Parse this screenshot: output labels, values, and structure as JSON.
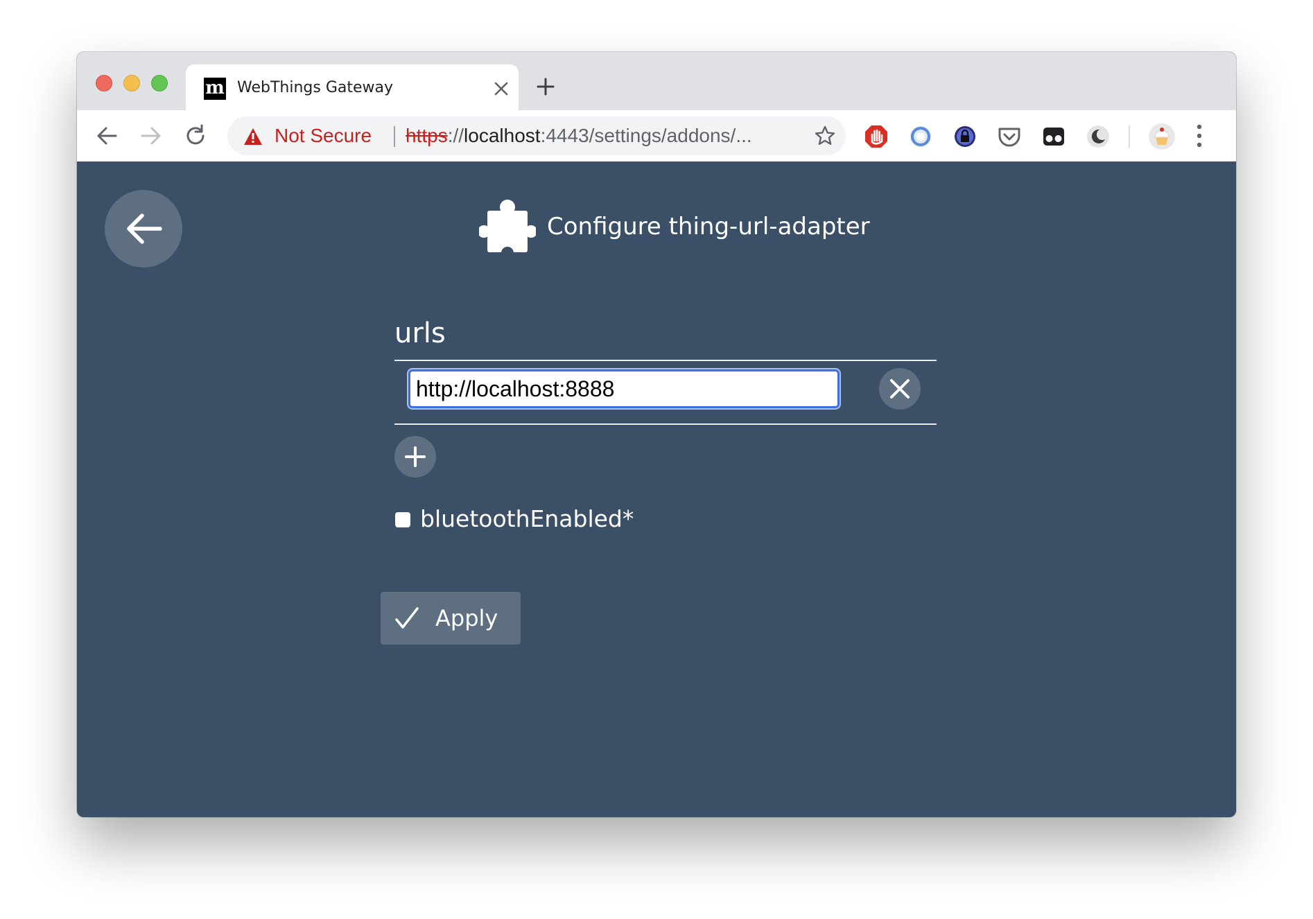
{
  "browser": {
    "tab": {
      "favicon_letter": "m",
      "title": "WebThings Gateway"
    },
    "omnibox": {
      "security_label": "Not Secure",
      "url_scheme": "https",
      "url_sep": "://",
      "url_host": "localhost",
      "url_rest": ":4443/settings/addons/..."
    },
    "extensions": [
      "adblock-icon",
      "ring-icon",
      "lock-shield-icon",
      "pocket-icon",
      "glasses-icon",
      "moon-icon",
      "cupcake-avatar-icon"
    ]
  },
  "page": {
    "title": "Configure thing-url-adapter",
    "form": {
      "urls_label": "urls",
      "urls": [
        "http://localhost:8888"
      ],
      "checkbox_label": "bluetoothEnabled*",
      "checkbox_checked": false,
      "apply_label": "Apply"
    }
  },
  "colors": {
    "page_bg": "#3b5067",
    "button_bg": "#5d6f80",
    "warning_red": "#c5221f",
    "input_focus": "#3d6fe0"
  }
}
